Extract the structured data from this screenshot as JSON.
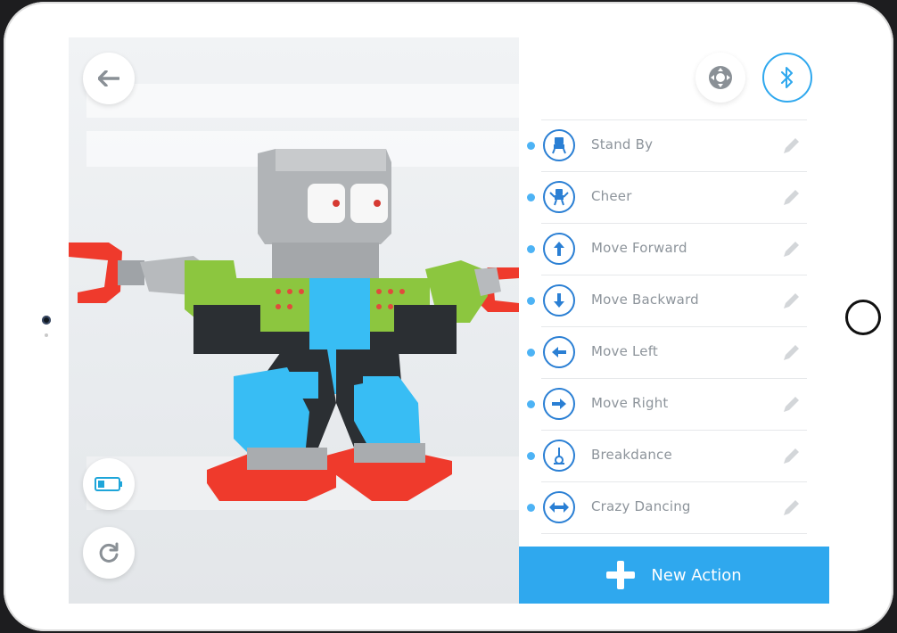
{
  "viewport": {
    "icons": {
      "back": "arrow-left-icon",
      "battery": "battery-icon",
      "reset": "rotate-icon"
    },
    "model": "robot-3d-model"
  },
  "panel": {
    "icons": {
      "joystick": "joystick-icon",
      "bluetooth": "bluetooth-icon",
      "edit": "pencil-icon"
    },
    "actions": [
      {
        "label": "Stand By",
        "icon": "robot-stand-icon"
      },
      {
        "label": "Cheer",
        "icon": "robot-cheer-icon"
      },
      {
        "label": "Move Forward",
        "icon": "arrow-up-icon"
      },
      {
        "label": "Move Backward",
        "icon": "arrow-down-icon"
      },
      {
        "label": "Move Left",
        "icon": "arrow-left-icon"
      },
      {
        "label": "Move Right",
        "icon": "arrow-right-icon"
      },
      {
        "label": "Breakdance",
        "icon": "breakdance-icon"
      },
      {
        "label": "Crazy Dancing",
        "icon": "arrow-left-right-icon"
      }
    ],
    "new_action_label": "New Action"
  },
  "colors": {
    "accent": "#2fa8ee",
    "icon_ring": "#2a7fd4",
    "label_text": "#8d949b",
    "robot_green": "#8cc63f",
    "robot_blue": "#29b6f6",
    "robot_red": "#f0392b",
    "robot_gray": "#b5b8bb"
  }
}
